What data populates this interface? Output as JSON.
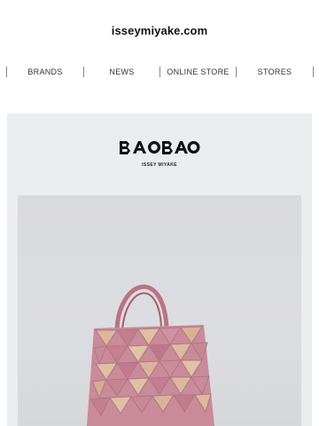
{
  "header": {
    "site": "isseymiyake.com"
  },
  "nav": {
    "items": [
      {
        "label": "BRANDS"
      },
      {
        "label": "NEWS"
      },
      {
        "label": "ONLINE STORE"
      },
      {
        "label": "STORES"
      }
    ]
  },
  "feature": {
    "logo_text": "BAOBAO",
    "logo_subtitle": "ISSEY MIYAKE",
    "image_alt": "Pink iridescent BAO BAO geometric tote bag",
    "colors": {
      "panel": "#e9edf0",
      "bag_pink": "#c98a9a",
      "bag_gold": "#d9b59a",
      "handle": "#b97480"
    }
  }
}
